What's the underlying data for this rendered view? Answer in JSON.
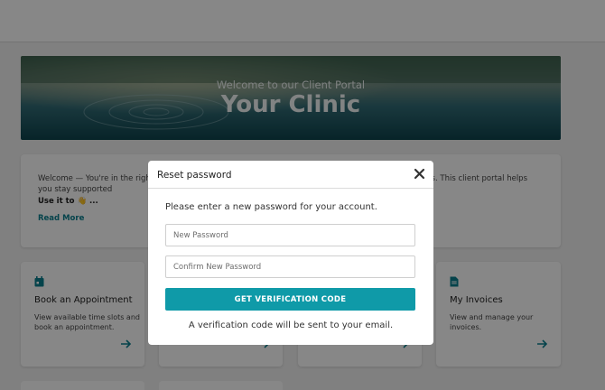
{
  "hero": {
    "subtitle": "Welcome to our Client Portal",
    "title": "Your Clinic"
  },
  "welcome": {
    "text": "Welcome — You're in the right place. Your care, your privacy and your progress are protected — always. This client portal helps you stay supported",
    "use_prefix": "Use it to 👋 ...",
    "read_more": "Read More"
  },
  "cards": [
    {
      "title": "Book an Appointment",
      "desc": "View available time slots and book an appointment.",
      "icon": "calendar-icon"
    },
    {
      "title": "",
      "desc": "",
      "icon": ""
    },
    {
      "title": "",
      "desc": "",
      "icon": ""
    },
    {
      "title": "My Invoices",
      "desc": "View and manage your invoices.",
      "icon": "document-icon"
    }
  ],
  "modal": {
    "title": "Reset password",
    "instruction": "Please enter a new password for your account.",
    "new_password_placeholder": "New Password",
    "confirm_password_placeholder": "Confirm New Password",
    "button_label": "GET VERIFICATION CODE",
    "note": "A verification code will be sent to your email."
  },
  "colors": {
    "accent": "#0f9aa8",
    "link": "#0a7f8f"
  }
}
